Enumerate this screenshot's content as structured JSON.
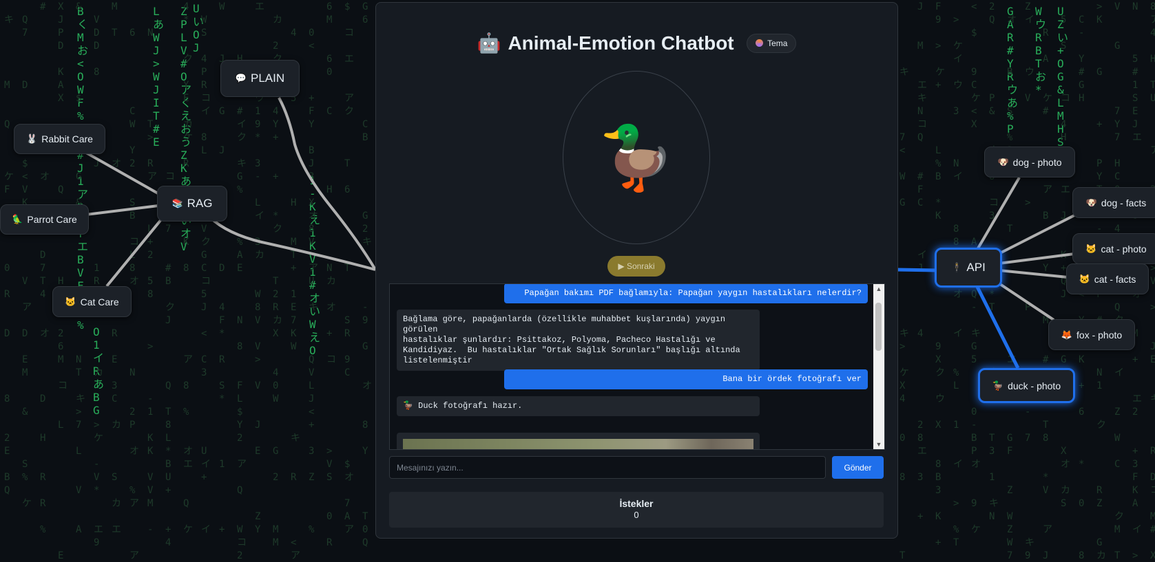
{
  "matrix": {
    "columns": [
      [
        "B",
        "く",
        "M",
        "お",
        "<",
        "O",
        "W",
        "F",
        "%",
        "$",
        ">",
        "#",
        "J",
        "1",
        "ア",
        "B",
        "S",
        "T",
        "エ",
        "B",
        "V",
        "F",
        "L",
        "Q",
        "%"
      ],
      [
        "O",
        "1",
        "イ",
        "R",
        "あ",
        "B",
        "G"
      ],
      [
        "L",
        "あ",
        "W",
        "J",
        ">",
        "W",
        "J",
        "I",
        "T",
        "#",
        "E"
      ],
      [
        "U",
        "い",
        "O",
        "J"
      ],
      [
        "Z",
        "P",
        "L",
        "V",
        "#",
        "O",
        "ア",
        "く",
        "え",
        "お",
        "う",
        "Z",
        "K",
        "あ",
        "っ",
        "C",
        "い",
        "オ",
        "V"
      ],
      [
        "1",
        "-",
        "K",
        "え",
        "1",
        "K",
        "V",
        "1",
        "#",
        "オ",
        "い",
        "W",
        "え",
        "O"
      ],
      [
        "G",
        "A",
        "R",
        "#",
        "Y",
        "R",
        "ウ",
        "あ",
        "%",
        "P"
      ],
      [
        "W",
        "ウ",
        "R",
        "B",
        "T",
        "お",
        "*"
      ],
      [
        "U",
        "Z",
        "い",
        "+",
        "O",
        "G",
        "&",
        "L",
        "M",
        "H",
        "S"
      ]
    ],
    "color": "#2ec866"
  },
  "nodes": {
    "rabbit_care": {
      "label": "Rabbit Care",
      "icon": "🐰"
    },
    "parrot_care": {
      "label": "Parrot Care",
      "icon": "🦜"
    },
    "cat_care": {
      "label": "Cat Care",
      "icon": "🐱"
    },
    "rag": {
      "label": "RAG",
      "icon": "📚"
    },
    "plain": {
      "label": "PLAIN",
      "icon": "💬"
    },
    "api": {
      "label": "API",
      "icon": "🕴"
    },
    "dog_photo": {
      "label": "dog - photo",
      "icon": "🐶"
    },
    "dog_facts": {
      "label": "dog - facts",
      "icon": "🐶"
    },
    "cat_photo": {
      "label": "cat - photo",
      "icon": "🐱"
    },
    "cat_facts": {
      "label": "cat - facts",
      "icon": "🐱"
    },
    "fox_photo": {
      "label": "fox - photo",
      "icon": "🦊"
    },
    "duck_photo": {
      "label": "duck - photo",
      "icon": "🦆"
    }
  },
  "header": {
    "title": "Animal-Emotion Chatbot",
    "robot_icon": "🤖",
    "theme_label": "Tema"
  },
  "avatar": {
    "emoji": "🦆"
  },
  "next_button": {
    "label": "▶ Sonraki"
  },
  "chat": {
    "messages": [
      {
        "role": "user",
        "text": "Papağan bakımı PDF bağlamıyla: Papağan yaygın hastalıkları nelerdir?"
      },
      {
        "role": "bot",
        "text": "Bağlama göre, papağanlarda (özellikle muhabbet kuşlarında) yaygın görülen\nhastalıklar şunlardır: Psittakoz, Polyoma, Pacheco Hastalığı ve\nKandidiyaz.  Bu hastalıklar \"Ortak Sağlık Sorunları\" başlığı altında\nlistelenmiştir"
      },
      {
        "role": "user",
        "text": "Bana bir ördek fotoğrafı ver"
      },
      {
        "role": "bot",
        "text": "🦆 Duck fotoğrafı hazır."
      }
    ]
  },
  "input": {
    "placeholder": "Mesajınızı yazın...",
    "value": ""
  },
  "send_button": {
    "label": "Gönder"
  },
  "stats": {
    "label": "İstekler",
    "value": "0"
  },
  "colors": {
    "accent": "#1f6feb",
    "link": "#b0b0b0",
    "panel": "#161b22"
  }
}
